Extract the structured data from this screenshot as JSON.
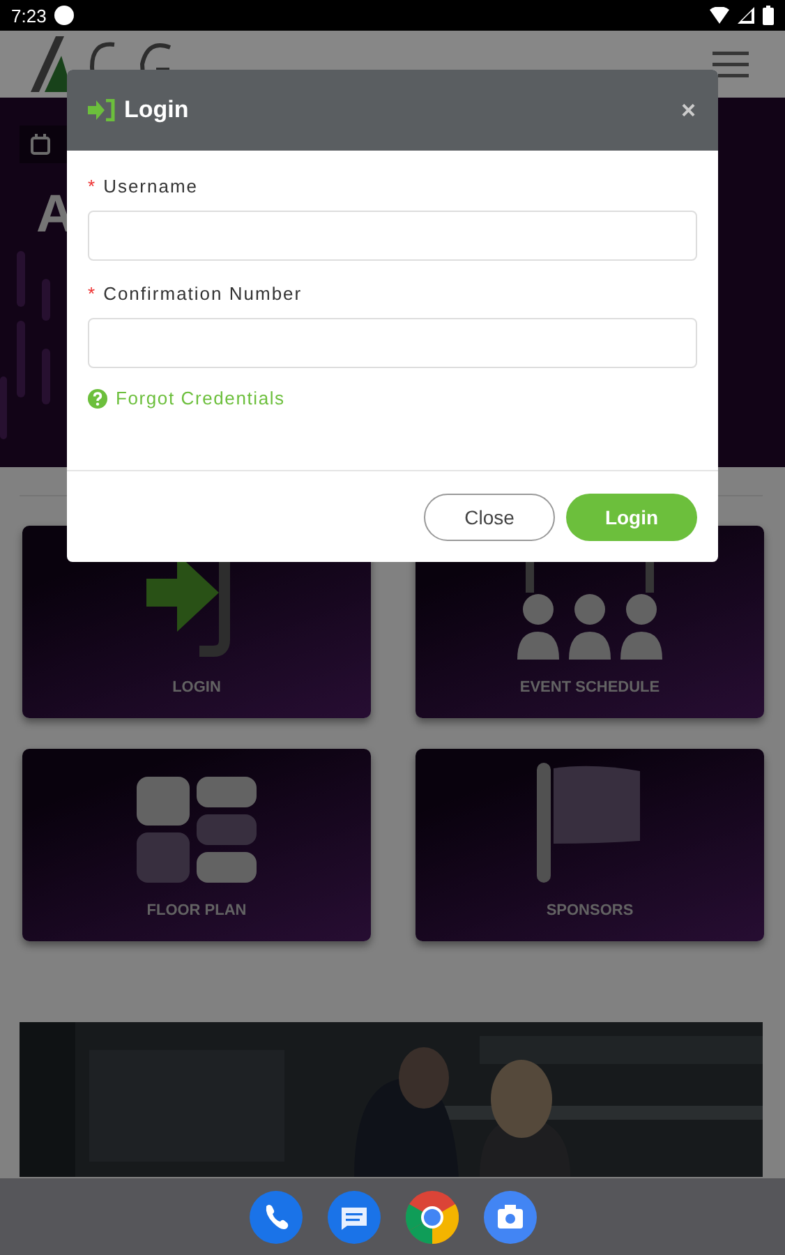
{
  "status_bar": {
    "time": "7:23"
  },
  "hero": {
    "title": "A"
  },
  "tiles": [
    {
      "label": "LOGIN",
      "kind": "login"
    },
    {
      "label": "EVENT SCHEDULE",
      "kind": "people"
    },
    {
      "label": "FLOOR PLAN",
      "kind": "grid"
    },
    {
      "label": "SPONSORS",
      "kind": "flag"
    }
  ],
  "modal": {
    "title": "Login",
    "close": "×",
    "fields": [
      {
        "label": "Username",
        "required_mark": "*"
      },
      {
        "label": "Confirmation Number",
        "required_mark": "*"
      }
    ],
    "forgot_link": "Forgot Credentials",
    "buttons": [
      {
        "label": "Close",
        "kind": "secondary"
      },
      {
        "label": "Login",
        "kind": "primary"
      }
    ]
  },
  "nav_bar": {
    "apps": [
      {
        "kind": "phone"
      },
      {
        "kind": "messages"
      },
      {
        "kind": "browser"
      },
      {
        "kind": "camera"
      }
    ]
  }
}
